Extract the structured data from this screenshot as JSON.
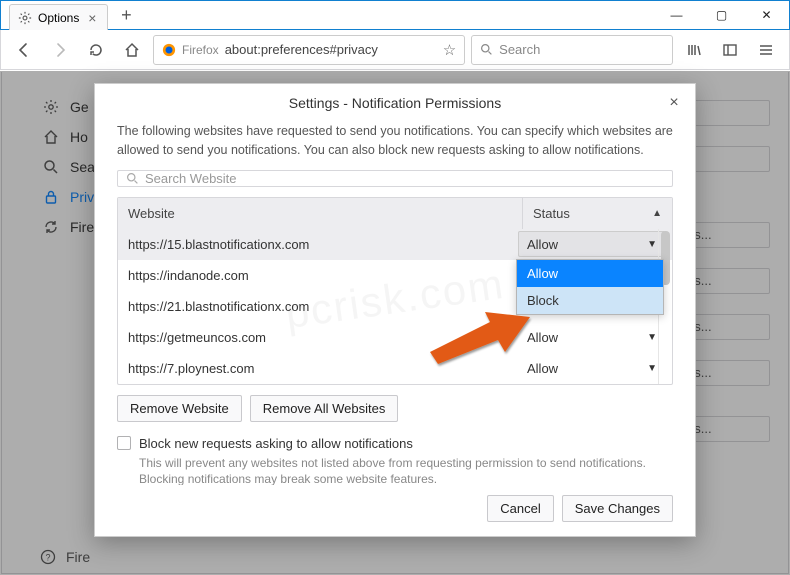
{
  "titlebar": {
    "tab_name": "Options"
  },
  "toolbar": {
    "identity_label": "Firefox",
    "url": "about:preferences#privacy",
    "search_placeholder": "Search"
  },
  "sidebar": {
    "items": [
      {
        "label": "Ge"
      },
      {
        "label": "Ho"
      },
      {
        "label": "Sea"
      },
      {
        "label": "Priv"
      },
      {
        "label": "Fire"
      }
    ],
    "support": "Fire"
  },
  "right_suffix": "ns...",
  "dialog": {
    "title": "Settings - Notification Permissions",
    "description": "The following websites have requested to send you notifications. You can specify which websites are allowed to send you notifications. You can also block new requests asking to allow notifications.",
    "search_placeholder": "Search Website",
    "columns": {
      "website": "Website",
      "status": "Status"
    },
    "rows": [
      {
        "url": "https://15.blastnotificationx.com",
        "status": "Allow"
      },
      {
        "url": "https://indanode.com",
        "status": "Allow"
      },
      {
        "url": "https://21.blastnotificationx.com",
        "status": "Allow"
      },
      {
        "url": "https://getmeuncos.com",
        "status": "Allow"
      },
      {
        "url": "https://7.ploynest.com",
        "status": "Allow"
      }
    ],
    "dropdown_options": {
      "allow": "Allow",
      "block": "Block"
    },
    "remove_website": "Remove Website",
    "remove_all": "Remove All Websites",
    "block_new_label": "Block new requests asking to allow notifications",
    "block_new_note": "This will prevent any websites not listed above from requesting permission to send notifications. Blocking notifications may break some website features.",
    "cancel": "Cancel",
    "save": "Save Changes"
  }
}
